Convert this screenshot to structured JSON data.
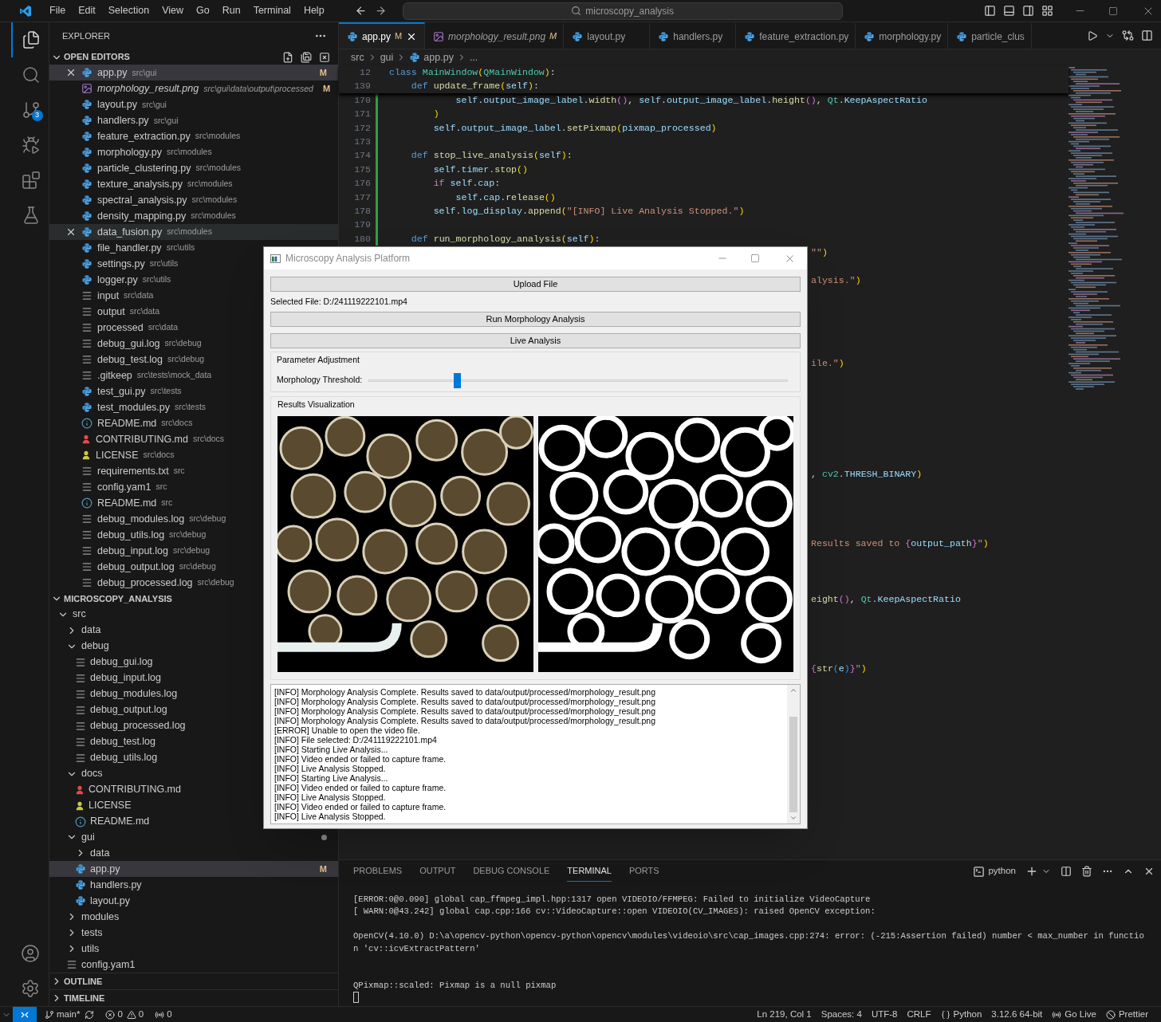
{
  "menu": [
    "File",
    "Edit",
    "Selection",
    "View",
    "Go",
    "Run",
    "Terminal",
    "Help"
  ],
  "command_center": {
    "text": "microscopy_analysis"
  },
  "activity_bar": {
    "items": [
      {
        "kind": "explorer",
        "selected": true
      },
      {
        "kind": "search",
        "selected": false
      },
      {
        "kind": "source-control",
        "selected": false,
        "badge": "3"
      },
      {
        "kind": "run",
        "selected": false
      },
      {
        "kind": "extensions",
        "selected": false
      },
      {
        "kind": "testing",
        "selected": false
      }
    ],
    "bottom": [
      {
        "kind": "account"
      },
      {
        "kind": "settings"
      }
    ]
  },
  "explorer": {
    "title": "EXPLORER",
    "open_editors": {
      "title": "OPEN EDITORS",
      "expanded": true,
      "items": [
        {
          "name": "app.py",
          "path": "src\\gui",
          "kind": "python",
          "badge": "M",
          "selected": true,
          "hovered": false,
          "preview": false
        },
        {
          "name": "morphology_result.png",
          "path": "src\\gui\\data\\output\\processed",
          "kind": "image",
          "badge": "M",
          "selected": false,
          "hovered": false,
          "preview": true
        },
        {
          "name": "layout.py",
          "path": "src\\gui",
          "kind": "python",
          "selected": false,
          "hovered": false,
          "preview": false
        },
        {
          "name": "handlers.py",
          "path": "src\\gui",
          "kind": "python",
          "selected": false,
          "hovered": false,
          "preview": false
        },
        {
          "name": "feature_extraction.py",
          "path": "src\\modules",
          "kind": "python",
          "selected": false,
          "hovered": false,
          "preview": false
        },
        {
          "name": "morphology.py",
          "path": "src\\modules",
          "kind": "python",
          "selected": false,
          "hovered": false,
          "preview": false
        },
        {
          "name": "particle_clustering.py",
          "path": "src\\modules",
          "kind": "python",
          "selected": false,
          "hovered": false,
          "preview": false
        },
        {
          "name": "texture_analysis.py",
          "path": "src\\modules",
          "kind": "python",
          "selected": false,
          "hovered": false,
          "preview": false
        },
        {
          "name": "spectral_analysis.py",
          "path": "src\\modules",
          "kind": "python",
          "selected": false,
          "hovered": false,
          "preview": false
        },
        {
          "name": "density_mapping.py",
          "path": "src\\modules",
          "kind": "python",
          "selected": false,
          "hovered": false,
          "preview": false
        },
        {
          "name": "data_fusion.py",
          "path": "src\\modules",
          "kind": "python",
          "selected": false,
          "hovered": true,
          "preview": false
        },
        {
          "name": "file_handler.py",
          "path": "src\\utils",
          "kind": "python",
          "selected": false,
          "hovered": false,
          "preview": false
        },
        {
          "name": "settings.py",
          "path": "src\\utils",
          "kind": "python",
          "selected": false,
          "hovered": false,
          "preview": false
        },
        {
          "name": "logger.py",
          "path": "src\\utils",
          "kind": "python",
          "selected": false,
          "hovered": false,
          "preview": false
        },
        {
          "name": "input",
          "path": "src\\data",
          "kind": "text",
          "selected": false,
          "hovered": false,
          "preview": false
        },
        {
          "name": "output",
          "path": "src\\data",
          "kind": "text",
          "selected": false,
          "hovered": false,
          "preview": false
        },
        {
          "name": "processed",
          "path": "src\\data",
          "kind": "text",
          "selected": false,
          "hovered": false,
          "preview": false
        },
        {
          "name": "debug_gui.log",
          "path": "src\\debug",
          "kind": "text",
          "selected": false,
          "hovered": false,
          "preview": false
        },
        {
          "name": "debug_test.log",
          "path": "src\\debug",
          "kind": "text",
          "selected": false,
          "hovered": false,
          "preview": false
        },
        {
          "name": ".gitkeep",
          "path": "src\\tests\\mock_data",
          "kind": "text",
          "selected": false,
          "hovered": false,
          "preview": false
        },
        {
          "name": "test_gui.py",
          "path": "src\\tests",
          "kind": "python",
          "selected": false,
          "hovered": false,
          "preview": false
        },
        {
          "name": "test_modules.py",
          "path": "src\\tests",
          "kind": "python",
          "selected": false,
          "hovered": false,
          "preview": false
        },
        {
          "name": "README.md",
          "path": "src\\docs",
          "kind": "info",
          "selected": false,
          "hovered": false,
          "preview": false
        },
        {
          "name": "CONTRIBUTING.md",
          "path": "src\\docs",
          "kind": "person",
          "color": "#e8474b",
          "selected": false,
          "hovered": false,
          "preview": false
        },
        {
          "name": "LICENSE",
          "path": "src\\docs",
          "kind": "person",
          "color": "#cbcb41",
          "selected": false,
          "hovered": false,
          "preview": false
        },
        {
          "name": "requirements.txt",
          "path": "src",
          "kind": "text",
          "selected": false,
          "hovered": false,
          "preview": false
        },
        {
          "name": "config.yam1",
          "path": "src",
          "kind": "text",
          "selected": false,
          "hovered": false,
          "preview": false
        },
        {
          "name": "README.md",
          "path": "src",
          "kind": "info",
          "selected": false,
          "hovered": false,
          "preview": false
        },
        {
          "name": "debug_modules.log",
          "path": "src\\debug",
          "kind": "text",
          "selected": false,
          "hovered": false,
          "preview": false
        },
        {
          "name": "debug_utils.log",
          "path": "src\\debug",
          "kind": "text",
          "selected": false,
          "hovered": false,
          "preview": false
        },
        {
          "name": "debug_input.log",
          "path": "src\\debug",
          "kind": "text",
          "selected": false,
          "hovered": false,
          "preview": false
        },
        {
          "name": "debug_output.log",
          "path": "src\\debug",
          "kind": "text",
          "selected": false,
          "hovered": false,
          "preview": false
        },
        {
          "name": "debug_processed.log",
          "path": "src\\debug",
          "kind": "text",
          "selected": false,
          "hovered": false,
          "preview": false
        }
      ]
    },
    "project": {
      "title": "MICROSCOPY_ANALYSIS",
      "expanded": true,
      "tree": [
        {
          "name": "src",
          "kind": "folder",
          "expanded": true,
          "children": [
            {
              "name": "data",
              "kind": "folder",
              "expanded": false
            },
            {
              "name": "debug",
              "kind": "folder",
              "expanded": true,
              "children": [
                {
                  "name": "debug_gui.log",
                  "kind": "text"
                },
                {
                  "name": "debug_input.log",
                  "kind": "text"
                },
                {
                  "name": "debug_modules.log",
                  "kind": "text"
                },
                {
                  "name": "debug_output.log",
                  "kind": "text"
                },
                {
                  "name": "debug_processed.log",
                  "kind": "text"
                },
                {
                  "name": "debug_test.log",
                  "kind": "text"
                },
                {
                  "name": "debug_utils.log",
                  "kind": "text"
                }
              ]
            },
            {
              "name": "docs",
              "kind": "folder",
              "expanded": true,
              "children": [
                {
                  "name": "CONTRIBUTING.md",
                  "kind": "person",
                  "color": "#e8474b"
                },
                {
                  "name": "LICENSE",
                  "kind": "person",
                  "color": "#cbcb41"
                },
                {
                  "name": "README.md",
                  "kind": "info"
                }
              ]
            },
            {
              "name": "gui",
              "kind": "folder",
              "expanded": true,
              "modified": true,
              "children": [
                {
                  "name": "data",
                  "kind": "folder",
                  "expanded": false
                },
                {
                  "name": "app.py",
                  "kind": "python",
                  "selected": true,
                  "badge": "M"
                },
                {
                  "name": "handlers.py",
                  "kind": "python",
                  "selected": false
                },
                {
                  "name": "layout.py",
                  "kind": "python",
                  "selected": false
                }
              ]
            },
            {
              "name": "modules",
              "kind": "folder",
              "expanded": false
            },
            {
              "name": "tests",
              "kind": "folder",
              "expanded": false
            },
            {
              "name": "utils",
              "kind": "folder",
              "expanded": false
            },
            {
              "name": "config.yam1",
              "kind": "text"
            }
          ]
        }
      ]
    },
    "outline": {
      "title": "OUTLINE",
      "expanded": false
    },
    "timeline": {
      "title": "TIMELINE",
      "expanded": false
    }
  },
  "tabs": [
    {
      "label": "app.py",
      "kind": "python",
      "badge": "M",
      "selected": true,
      "preview": false
    },
    {
      "label": "morphology_result.png",
      "kind": "image",
      "badge": "M",
      "selected": false,
      "preview": true
    },
    {
      "label": "layout.py",
      "kind": "python",
      "selected": false,
      "preview": false
    },
    {
      "label": "handlers.py",
      "kind": "python",
      "selected": false,
      "preview": false
    },
    {
      "label": "feature_extraction.py",
      "kind": "python",
      "selected": false,
      "preview": false
    },
    {
      "label": "morphology.py",
      "kind": "python",
      "selected": false,
      "preview": false
    },
    {
      "label": "particle_clus",
      "kind": "python",
      "selected": false,
      "preview": false
    }
  ],
  "breadcrumb": [
    "src",
    "gui",
    "app.py",
    "..."
  ],
  "editor": {
    "sticky_lines": [
      {
        "number": "12",
        "tokens": [
          {
            "kind": "kw",
            "text": "class "
          },
          {
            "kind": "cls",
            "text": "MainWindow"
          },
          {
            "kind": "b1",
            "text": "("
          },
          {
            "kind": "cls",
            "text": "QMainWindow"
          },
          {
            "kind": "b1",
            "text": ")"
          },
          {
            "kind": "p",
            "text": ":"
          }
        ]
      },
      {
        "number": "139",
        "tokens": [
          {
            "kind": "kw",
            "text": "    def "
          },
          {
            "kind": "fn",
            "text": "update_frame"
          },
          {
            "kind": "b1",
            "text": "("
          },
          {
            "kind": "var",
            "text": "self"
          },
          {
            "kind": "b1",
            "text": ")"
          },
          {
            "kind": "p",
            "text": ":"
          }
        ]
      }
    ],
    "lines": [
      {
        "number": "170",
        "tokens": [
          {
            "kind": "var",
            "text": "            self"
          },
          {
            "kind": "p",
            "text": "."
          },
          {
            "kind": "var",
            "text": "output_image_label"
          },
          {
            "kind": "p",
            "text": "."
          },
          {
            "kind": "fn",
            "text": "width"
          },
          {
            "kind": "b2",
            "text": "()"
          },
          {
            "kind": "p",
            "text": ", "
          },
          {
            "kind": "var",
            "text": "self"
          },
          {
            "kind": "p",
            "text": "."
          },
          {
            "kind": "var",
            "text": "output_image_label"
          },
          {
            "kind": "p",
            "text": "."
          },
          {
            "kind": "fn",
            "text": "height"
          },
          {
            "kind": "b2",
            "text": "()"
          },
          {
            "kind": "p",
            "text": ", "
          },
          {
            "kind": "cls",
            "text": "Qt"
          },
          {
            "kind": "p",
            "text": "."
          },
          {
            "kind": "var",
            "text": "KeepAspectRatio"
          }
        ]
      },
      {
        "number": "171",
        "tokens": [
          {
            "kind": "b1",
            "text": "        )"
          }
        ]
      },
      {
        "number": "172",
        "tokens": [
          {
            "kind": "var",
            "text": "        self"
          },
          {
            "kind": "p",
            "text": "."
          },
          {
            "kind": "var",
            "text": "output_image_label"
          },
          {
            "kind": "p",
            "text": "."
          },
          {
            "kind": "fn",
            "text": "setPixmap"
          },
          {
            "kind": "b1",
            "text": "("
          },
          {
            "kind": "var",
            "text": "pixmap_processed"
          },
          {
            "kind": "b1",
            "text": ")"
          }
        ]
      },
      {
        "number": "173"
      },
      {
        "number": "174",
        "tokens": [
          {
            "kind": "kw",
            "text": "    def "
          },
          {
            "kind": "fn",
            "text": "stop_live_analysis"
          },
          {
            "kind": "b1",
            "text": "("
          },
          {
            "kind": "var",
            "text": "self"
          },
          {
            "kind": "b1",
            "text": ")"
          },
          {
            "kind": "p",
            "text": ":"
          }
        ]
      },
      {
        "number": "175",
        "tokens": [
          {
            "kind": "var",
            "text": "        self"
          },
          {
            "kind": "p",
            "text": "."
          },
          {
            "kind": "var",
            "text": "timer"
          },
          {
            "kind": "p",
            "text": "."
          },
          {
            "kind": "fn",
            "text": "stop"
          },
          {
            "kind": "b1",
            "text": "()"
          }
        ]
      },
      {
        "number": "176",
        "tokens": [
          {
            "kind": "ctl",
            "text": "        if "
          },
          {
            "kind": "var",
            "text": "self"
          },
          {
            "kind": "p",
            "text": "."
          },
          {
            "kind": "var",
            "text": "cap"
          },
          {
            "kind": "p",
            "text": ":"
          }
        ]
      },
      {
        "number": "177",
        "tokens": [
          {
            "kind": "var",
            "text": "            self"
          },
          {
            "kind": "p",
            "text": "."
          },
          {
            "kind": "var",
            "text": "cap"
          },
          {
            "kind": "p",
            "text": "."
          },
          {
            "kind": "fn",
            "text": "release"
          },
          {
            "kind": "b1",
            "text": "()"
          }
        ]
      },
      {
        "number": "178",
        "tokens": [
          {
            "kind": "var",
            "text": "        self"
          },
          {
            "kind": "p",
            "text": "."
          },
          {
            "kind": "var",
            "text": "log_display"
          },
          {
            "kind": "p",
            "text": "."
          },
          {
            "kind": "fn",
            "text": "append"
          },
          {
            "kind": "b1",
            "text": "("
          },
          {
            "kind": "str",
            "text": "\"[INFO] Live Analysis Stopped.\""
          },
          {
            "kind": "b1",
            "text": ")"
          }
        ]
      },
      {
        "number": "179"
      },
      {
        "number": "180",
        "tokens": [
          {
            "kind": "kw",
            "text": "    def "
          },
          {
            "kind": "fn",
            "text": "run_morphology_analysis"
          },
          {
            "kind": "b1",
            "text": "("
          },
          {
            "kind": "var",
            "text": "self"
          },
          {
            "kind": "b1",
            "text": ")"
          },
          {
            "kind": "p",
            "text": ":"
          }
        ]
      }
    ],
    "fragments": [
      {
        "tokens": [
          {
            "kind": "str",
            "text": "\"\""
          },
          {
            "kind": "b1",
            "text": ")"
          }
        ]
      },
      {
        "tokens": [
          {
            "kind": "str",
            "text": "alysis.\""
          },
          {
            "kind": "b1",
            "text": ")"
          }
        ]
      },
      {
        "tokens": [
          {
            "kind": "str",
            "text": "ile.\""
          },
          {
            "kind": "b1",
            "text": ")"
          }
        ]
      },
      {
        "tokens": [
          {
            "kind": "p",
            "text": ", "
          },
          {
            "kind": "cls",
            "text": "cv2"
          },
          {
            "kind": "p",
            "text": "."
          },
          {
            "kind": "var",
            "text": "THRESH_BINARY"
          },
          {
            "kind": "b1",
            "text": ")"
          }
        ]
      },
      {
        "tokens": [
          {
            "kind": "str",
            "text": "Results saved to "
          },
          {
            "kind": "b2",
            "text": "{"
          },
          {
            "kind": "var",
            "text": "output_path"
          },
          {
            "kind": "b2",
            "text": "}"
          },
          {
            "kind": "str",
            "text": "\""
          },
          {
            "kind": "b1",
            "text": ")"
          }
        ]
      },
      {
        "tokens": [
          {
            "kind": "fn",
            "text": "eight"
          },
          {
            "kind": "b2",
            "text": "()"
          },
          {
            "kind": "p",
            "text": ", "
          },
          {
            "kind": "cls",
            "text": "Qt"
          },
          {
            "kind": "p",
            "text": "."
          },
          {
            "kind": "var",
            "text": "KeepAspectRatio"
          }
        ]
      },
      {
        "tokens": [
          {
            "kind": "b2",
            "text": "{"
          },
          {
            "kind": "fn",
            "text": "str"
          },
          {
            "kind": "b3",
            "text": "("
          },
          {
            "kind": "var",
            "text": "e"
          },
          {
            "kind": "b3",
            "text": ")"
          },
          {
            "kind": "b2",
            "text": "}"
          },
          {
            "kind": "str",
            "text": "\""
          },
          {
            "kind": "b1",
            "text": ")"
          }
        ]
      }
    ]
  },
  "panel": {
    "tabs": [
      {
        "label": "PROBLEMS",
        "selected": false
      },
      {
        "label": "OUTPUT",
        "selected": false
      },
      {
        "label": "DEBUG CONSOLE",
        "selected": false
      },
      {
        "label": "TERMINAL",
        "selected": true
      },
      {
        "label": "PORTS",
        "selected": false
      }
    ],
    "terminal_name": "python",
    "blocks": [
      [
        "[ERROR:0@0.090] global cap_ffmpeg_impl.hpp:1317 open VIDEOIO/FFMPEG: Failed to initialize VideoCapture",
        "[ WARN:0@43.242] global cap.cpp:166 cv::VideoCapture::open VIDEOIO(CV_IMAGES): raised OpenCV exception:"
      ],
      [
        "OpenCV(4.10.0) D:\\a\\opencv-python\\opencv-python\\opencv\\modules\\videoio\\src\\cap_images.cpp:274: error: (-215:Assertion failed) number < max_number in functio",
        "n 'cv::icvExtractPattern'"
      ],
      [
        "QPixmap::scaled: Pixmap is a null pixmap"
      ]
    ]
  },
  "status_bar": {
    "branch": "main*",
    "errors": "0",
    "warnings": "0",
    "ports": "0",
    "right": [
      {
        "kind": "text",
        "text": "Ln 219, Col 1"
      },
      {
        "kind": "text",
        "text": "Spaces: 4"
      },
      {
        "kind": "text",
        "text": "UTF-8"
      },
      {
        "kind": "text",
        "text": "CRLF"
      },
      {
        "kind": "language",
        "text": "Python"
      },
      {
        "kind": "text",
        "text": "3.12.6 64-bit"
      },
      {
        "kind": "golive",
        "text": "Go Live"
      },
      {
        "kind": "prettier",
        "text": "Prettier"
      }
    ]
  },
  "qt_window": {
    "title": "Microscopy Analysis Platform",
    "upload_button": "Upload File",
    "selected_file": "Selected File: D:/241119222101.mp4",
    "run_button": "Run Morphology Analysis",
    "live_button": "Live Analysis",
    "parameter_group": {
      "title": "Parameter Adjustment",
      "slider_label": "Morphology Threshold:",
      "level": 0.21
    },
    "results_group": {
      "title": "Results Visualization"
    },
    "log": [
      "[INFO] Morphology Analysis Complete. Results saved to data/output/processed/morphology_result.png",
      "[INFO] Morphology Analysis Complete. Results saved to data/output/processed/morphology_result.png",
      "[INFO] Morphology Analysis Complete. Results saved to data/output/processed/morphology_result.png",
      "[INFO] Morphology Analysis Complete. Results saved to data/output/processed/morphology_result.png",
      "[ERROR] Unable to open the video file.",
      "[INFO] File selected: D:/241119222101.mp4",
      "[INFO] Starting Live Analysis...",
      "[INFO] Video ended or failed to capture frame.",
      "[INFO] Live Analysis Stopped.",
      "[INFO] Starting Live Analysis...",
      "[INFO] Video ended or failed to capture frame.",
      "[INFO] Live Analysis Stopped.",
      "[INFO] Video ended or failed to capture frame.",
      "[INFO] Live Analysis Stopped."
    ]
  }
}
